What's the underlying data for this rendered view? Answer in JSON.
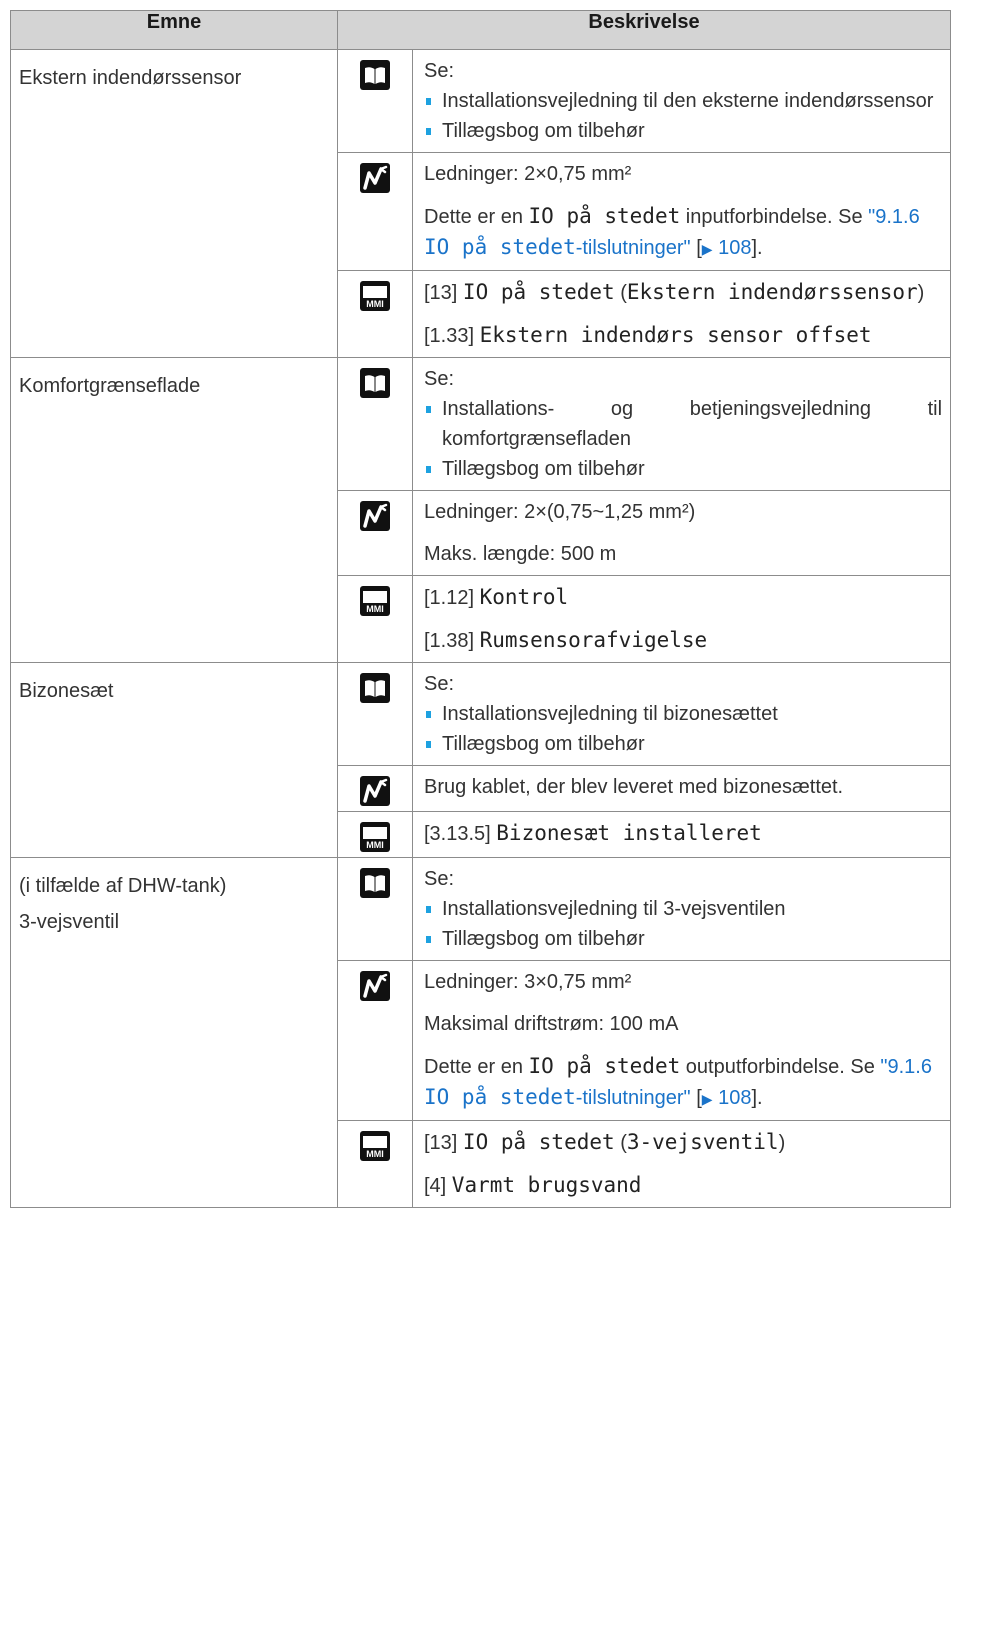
{
  "header": {
    "col1": "Emne",
    "col2": "Beskrivelse"
  },
  "rows": [
    {
      "topic": [
        "Ekstern indendørssensor"
      ],
      "book": {
        "lead": "Se:",
        "items": [
          "Installationsvejledning til den eksterne indendørssensor",
          "Tillægsbog om tilbehør"
        ]
      },
      "wiring": {
        "line1": "Ledninger: 2×0,75 mm²",
        "p2_a": "Dette er en ",
        "p2_mono": "IO på stedet",
        "p2_b": " inputforbindelse. Se ",
        "link_a": "\"9.1.6 ",
        "link_mono": "IO på stedet",
        "link_b": "-tilslutninger\"",
        "ref_open": " [",
        "ref_page": " 108",
        "ref_close": "]."
      },
      "mmi": [
        {
          "code": "[13] ",
          "mono": "IO på stedet",
          "extra_a": " (",
          "extra_mono": "Ekstern indendørssensor",
          "extra_b": ")"
        },
        {
          "code": "[1.33] ",
          "mono": "Ekstern indendørs sensor offset"
        }
      ]
    },
    {
      "topic": [
        "Komfortgrænseflade"
      ],
      "book": {
        "lead": "Se:",
        "items": [
          "Installations- og betjeningsvejledning til komfortgrænsefladen",
          "Tillægsbog om tilbehør"
        ]
      },
      "wiring": {
        "line1": "Ledninger: 2×(0,75~1,25 mm²)",
        "line2": "Maks. længde: 500 m"
      },
      "mmi": [
        {
          "code": "[1.12] ",
          "mono": "Kontrol"
        },
        {
          "code": "[1.38] ",
          "mono": "Rumsensorafvigelse"
        }
      ]
    },
    {
      "topic": [
        "Bizonesæt"
      ],
      "book": {
        "lead": "Se:",
        "items": [
          "Installationsvejledning til bizonesættet",
          "Tillægsbog om tilbehør"
        ]
      },
      "wiring": {
        "line1": "Brug kablet, der blev leveret med bizonesættet."
      },
      "mmi": [
        {
          "code": "[3.13.5] ",
          "mono": "Bizonesæt installeret"
        }
      ]
    },
    {
      "topic": [
        "(i tilfælde af DHW-tank)",
        "3-vejsventil"
      ],
      "book": {
        "lead": "Se:",
        "items": [
          "Installationsvejledning til 3-vejsventilen",
          "Tillægsbog om tilbehør"
        ]
      },
      "wiring": {
        "line1": "Ledninger: 3×0,75 mm²",
        "line2": "Maksimal driftstrøm: 100 mA",
        "p3_a": "Dette er en ",
        "p3_mono": "IO på stedet",
        "p3_b": " outputforbindelse. Se ",
        "link_a": "\"9.1.6 ",
        "link_mono": "IO på stedet",
        "link_b": "-tilslutninger\"",
        "ref_open": " [",
        "ref_page": " 108",
        "ref_close": "]."
      },
      "mmi": [
        {
          "code": "[13] ",
          "mono": "IO på stedet",
          "extra_a": " (",
          "extra_mono": "3-vejsventil",
          "extra_b": ")"
        },
        {
          "code": "[4] ",
          "mono": "Varmt brugsvand"
        }
      ]
    }
  ],
  "icons": {
    "book": "book-icon",
    "wiring": "wiring-icon",
    "mmi": "mmi-icon",
    "mmi_label": "MMI",
    "ref_arrow": "▶"
  }
}
